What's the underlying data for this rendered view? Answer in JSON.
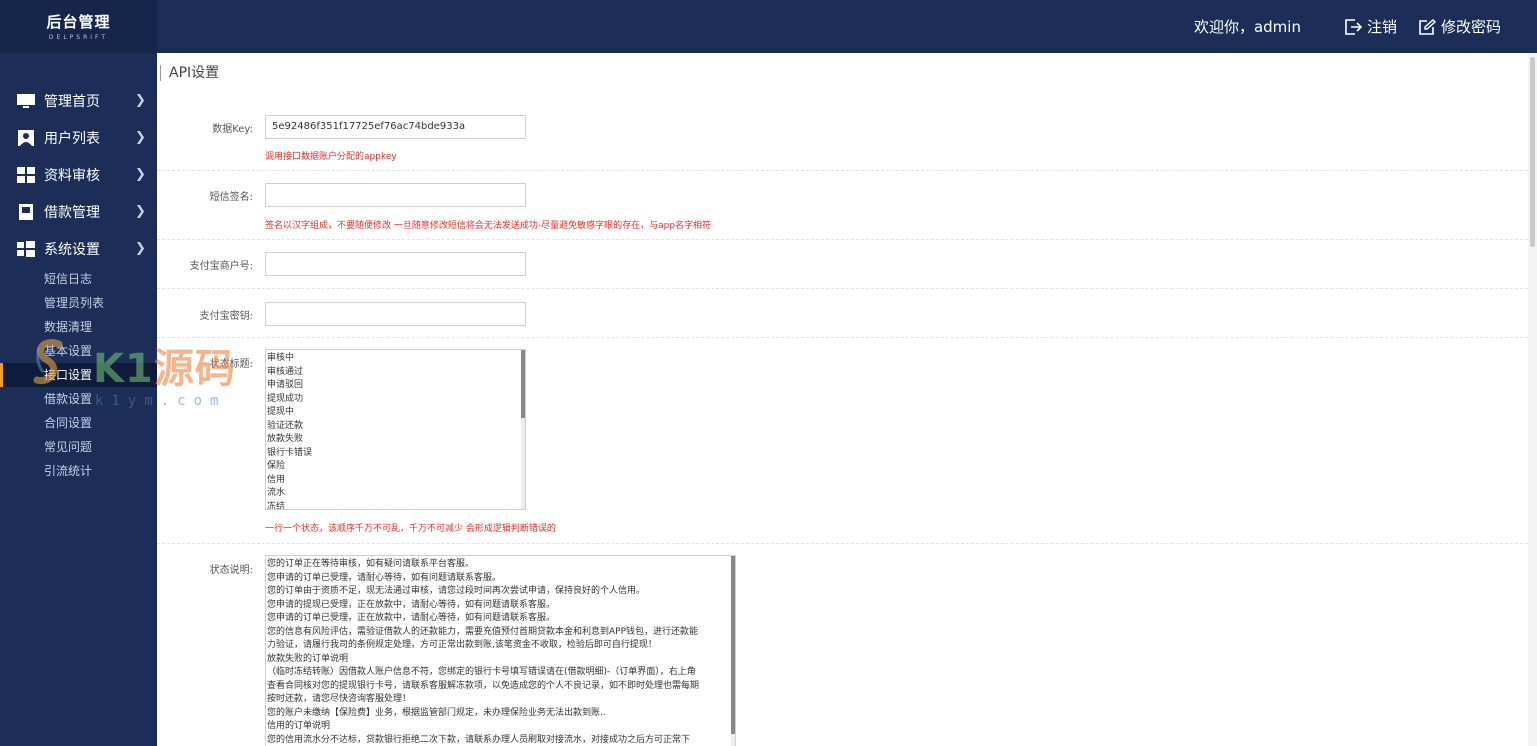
{
  "brand": {
    "title": "后台管理",
    "subtitle": "DELPSRIFT"
  },
  "header": {
    "welcome": "欢迎你，admin",
    "logout_label": "注销",
    "change_password_label": "修改密码"
  },
  "sidebar": {
    "items": [
      {
        "label": "管理首页",
        "icon": "monitor-icon"
      },
      {
        "label": "用户列表",
        "icon": "user-icon"
      },
      {
        "label": "资料审核",
        "icon": "grid-icon"
      },
      {
        "label": "借款管理",
        "icon": "book-icon"
      },
      {
        "label": "系统设置",
        "icon": "windows-icon"
      }
    ],
    "sub_items": [
      {
        "label": "短信日志"
      },
      {
        "label": "管理员列表"
      },
      {
        "label": "数据清理"
      },
      {
        "label": "基本设置"
      },
      {
        "label": "接口设置",
        "active": true
      },
      {
        "label": "借款设置"
      },
      {
        "label": "合同设置"
      },
      {
        "label": "常见问题"
      },
      {
        "label": "引流统计"
      }
    ]
  },
  "main": {
    "title": "API设置",
    "data_key": {
      "label": "数据Key:",
      "value": "5e92486f351f17725ef76ac74bde933a",
      "hint": "调用接口数据账户分配的appkey"
    },
    "sms_sign": {
      "label": "短信签名:",
      "value": "",
      "hint": "签名以汉字组成，不要随便修改 一旦随意修改短信将会无法发送成功-尽量避免敏感字眼的存在，与app名字相符"
    },
    "alipay_merchant": {
      "label": "支付宝商户号:",
      "value": ""
    },
    "alipay_secret": {
      "label": "支付宝密钥:",
      "value": ""
    },
    "status_titles": {
      "label": "状态标题:",
      "lines": [
        "审核中",
        "审核通过",
        "申请驳回",
        "提现成功",
        "提现中",
        "验证还款",
        "放款失败",
        "银行卡错误",
        "保险",
        "信用",
        "流水",
        "冻结"
      ],
      "scroll_fraction": 0.43,
      "hint": "一行一个状态，该顺序千万不可乱，千万不可减少 会形成逻辑判断错误的"
    },
    "status_desc": {
      "label": "状态说明:",
      "lines": [
        "您的订单正在等待审核，如有疑问请联系平台客服。",
        "您申请的订单已受理，请耐心等待，如有问题请联系客服。",
        "您的订单由于资质不足，现无法通过审核，请您过段时间再次尝试申请，保持良好的个人信用。",
        "您申请的提现已受理，正在放款中，请耐心等待，如有问题请联系客服。",
        "您申请的订单已受理，正在放款中，请耐心等待，如有问题请联系客服。",
        "您的信息有风险评估，需验证借款人的还款能力，需要充值预付首期贷款本金和利息到APP钱包，进行还款能",
        "力验证，请履行我司的条例规定处理，方可正常出款到账,该笔资金不收取，检验后即可自行提现！",
        "放款失败的订单说明",
        "（临时冻结转账）因借款人账户信息不符，您绑定的银行卡号填写错误请在(借款明细)-（订单界面），右上角",
        "查看合同核对您的提现银行卡号，请联系客服解冻款项，以免造成您的个人不良记录，如不即时处理也需每期",
        "按时还款，请您尽快咨询客服处理！",
        "您的账户未缴纳【保险费】业务，根据监管部门规定，未办理保险业务无法出款到账..",
        "信用的订单说明",
        "您的信用流水分不达标，贷款银行拒绝二次下款，请联系办理人员刷取对接流水，对接成功之后方可正常下"
      ],
      "scroll_fraction": 0.9
    }
  },
  "watermark": {
    "text_latin": "K1",
    "text_cn": "源码",
    "url": "k1ym.com"
  },
  "colors": {
    "nav_bg": "#1c2e57",
    "hint_red": "#e0312b",
    "accent": "#f0a020"
  }
}
